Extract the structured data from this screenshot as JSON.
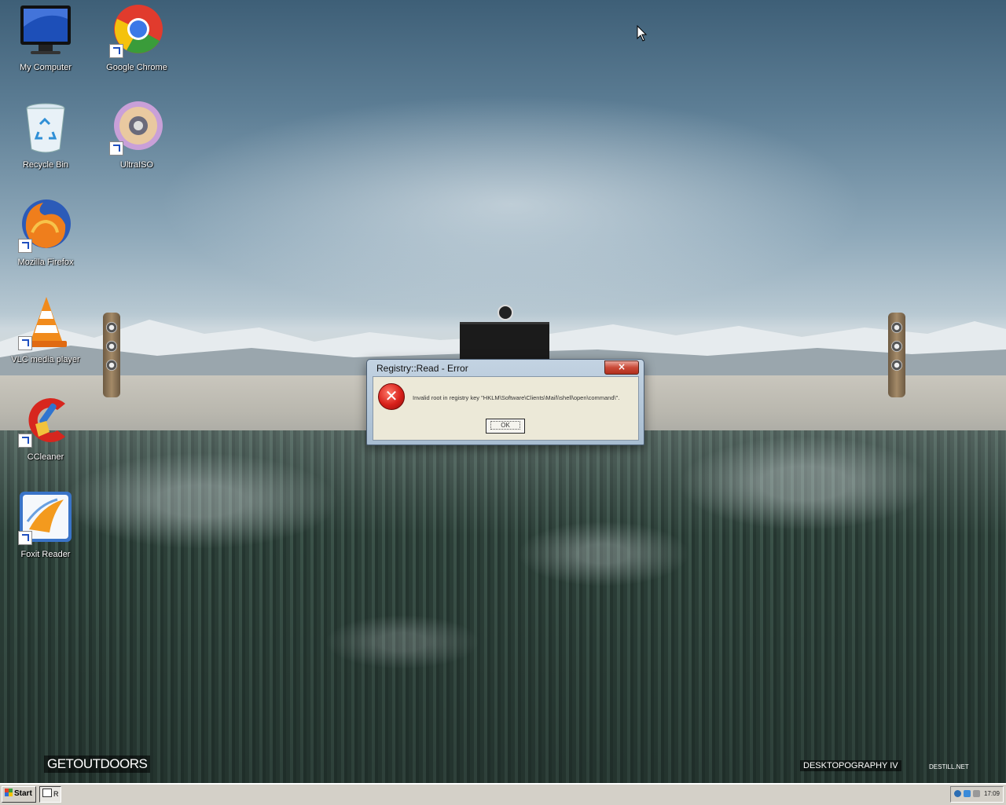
{
  "desktop": {
    "icons": [
      {
        "label": "My Computer",
        "icon": "monitor-icon"
      },
      {
        "label": "Google Chrome",
        "icon": "chrome-icon"
      },
      {
        "label": "Recycle Bin",
        "icon": "recycle-bin-icon"
      },
      {
        "label": "UltraISO",
        "icon": "disc-icon"
      },
      {
        "label": "Mozilla Firefox",
        "icon": "firefox-icon"
      },
      {
        "label": "VLC media player",
        "icon": "vlc-cone-icon"
      },
      {
        "label": "CCleaner",
        "icon": "ccleaner-icon"
      },
      {
        "label": "Foxit Reader",
        "icon": "foxit-icon"
      }
    ],
    "wallpaper_text": {
      "left": "GETOUTDOORS",
      "mid": "DESKTOPOGRAPHY IV",
      "right": "DESTILL.NET"
    }
  },
  "dialog": {
    "title": "Registry::Read - Error",
    "close_label": "×",
    "message": "Invalid root in registry key \"HKLM\\Software\\Clients\\Mail\\\\shell\\open\\command\\\".",
    "ok_label": "OK"
  },
  "taskbar": {
    "start_label": "Start",
    "task_label": "R",
    "clock": "17:09"
  },
  "colors": {
    "dialog_frame": "#a8bdd1",
    "close_button": "#c94a38",
    "error_red": "#d7201a",
    "taskbar": "#d4d0c8"
  }
}
